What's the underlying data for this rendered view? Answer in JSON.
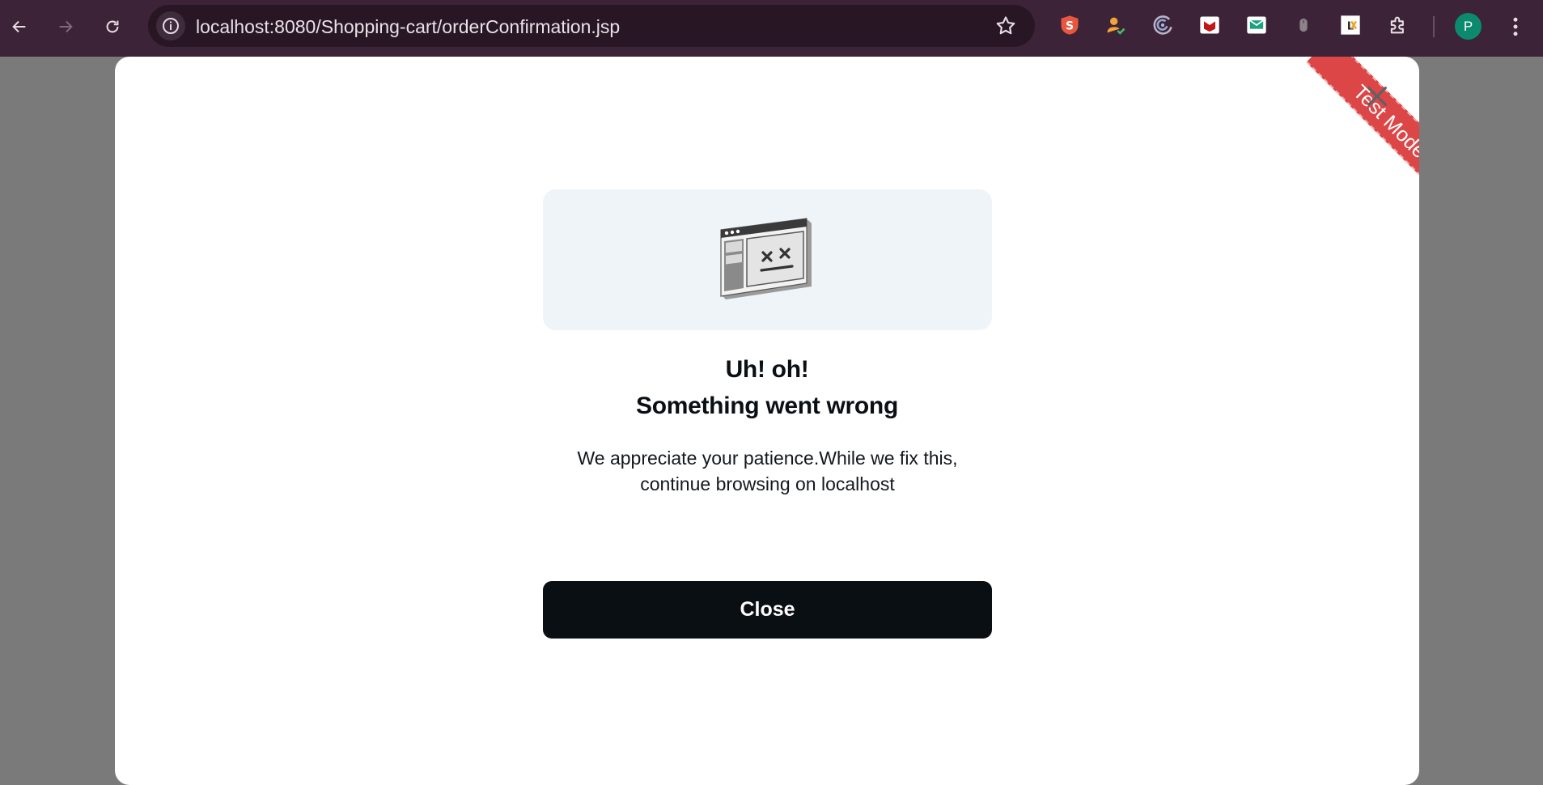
{
  "browser": {
    "url": "localhost:8080/Shopping-cart/orderConfirmation.jsp",
    "profile_initial": "P",
    "extensions": [
      "s-shield-extension-icon",
      "person-check-extension-icon",
      "swirl-extension-icon",
      "mcafee-extension-icon",
      "mail-extension-icon",
      "mouse-extension-icon",
      "lx-extension-icon",
      "puzzle-extensions-icon"
    ]
  },
  "modal": {
    "ribbon_text": "Test Mode",
    "title_line1": "Uh! oh!",
    "title_line2": "Something went wrong",
    "message": "We appreciate your patience.While we fix this, continue browsing on localhost",
    "close_button_label": "Close"
  },
  "colors": {
    "chrome_bg": "#3c2337",
    "ribbon": "#dc4646",
    "button_bg": "#0a0f14",
    "illustration_bg": "#eef4f8"
  }
}
